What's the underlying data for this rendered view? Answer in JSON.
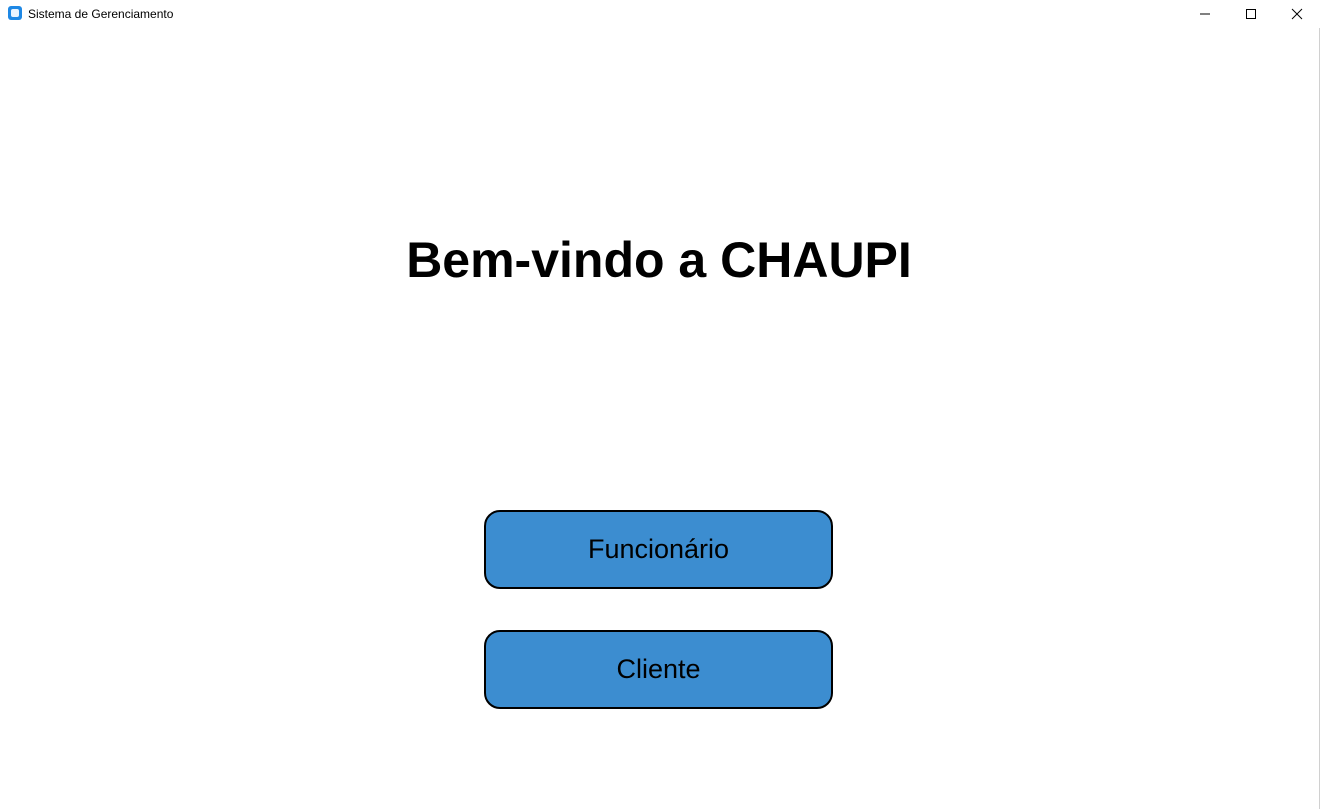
{
  "window": {
    "title": "Sistema de Gerenciamento",
    "app_icon": "app-window-icon",
    "controls": {
      "minimize_icon": "minimize-icon",
      "maximize_icon": "maximize-icon",
      "close_icon": "close-icon"
    }
  },
  "main": {
    "heading": "Bem-vindo a CHAUPI",
    "buttons": [
      {
        "label": "Funcionário"
      },
      {
        "label": "Cliente"
      }
    ]
  },
  "colors": {
    "button_fill": "#3c8dd0",
    "button_border": "#000000",
    "background": "#ffffff"
  }
}
